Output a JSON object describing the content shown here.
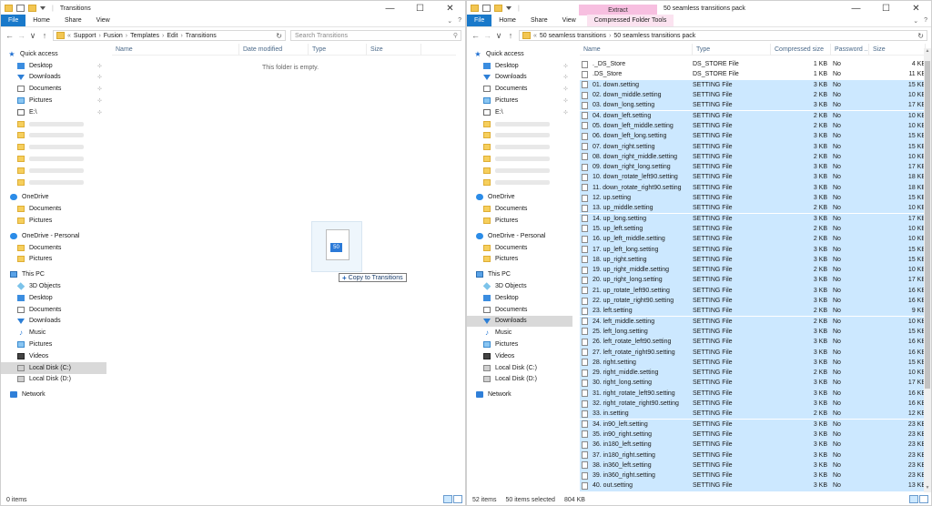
{
  "left_window": {
    "title": "Transitions",
    "window_controls": {
      "minimize": "—",
      "maximize": "☐",
      "close": "✕"
    },
    "ribbon_tabs": [
      "File",
      "Home",
      "Share",
      "View"
    ],
    "address": {
      "back": "←",
      "forward": "→",
      "recent": "∨",
      "up": "↑",
      "prefix": "«",
      "crumbs": [
        "Support",
        "Fusion",
        "Templates",
        "Edit",
        "Transitions"
      ],
      "separator": "›"
    },
    "search_placeholder": "Search Transitions",
    "columns": [
      "Name",
      "Date modified",
      "Type",
      "Size"
    ],
    "empty_message": "This folder is empty.",
    "drag": {
      "badge": "50",
      "tooltip": "Copy to Transitions",
      "tooltip_icon": "+"
    },
    "status": {
      "items": "0 items"
    }
  },
  "right_window": {
    "title": "50 seamless transitions pack",
    "window_controls": {
      "minimize": "—",
      "maximize": "☐",
      "close": "✕"
    },
    "ribbon_tabs": [
      "File",
      "Home",
      "Share",
      "View",
      "Compressed Folder Tools"
    ],
    "context_tab": "Extract",
    "address": {
      "back": "←",
      "forward": "→",
      "recent": "∨",
      "up": "↑",
      "prefix": "«",
      "crumbs": [
        "50 seamless transitions",
        "50 seamless transitions pack"
      ],
      "separator": "›"
    },
    "columns": [
      "Name",
      "Type",
      "Compressed size",
      "Password ...",
      "Size"
    ],
    "status": {
      "items": "52 items",
      "selected": "50 items selected",
      "size": "804 KB"
    }
  },
  "nav": {
    "quick_access": "Quick access",
    "quick_items": [
      "Desktop",
      "Downloads",
      "Documents",
      "Pictures",
      "E:\\"
    ],
    "onedrive": "OneDrive",
    "onedrive_items": [
      "Documents",
      "Pictures"
    ],
    "onedrive_personal": "OneDrive - Personal",
    "onedrive_personal_items": [
      "Documents",
      "Pictures"
    ],
    "this_pc": "This PC",
    "pc_items": [
      "3D Objects",
      "Desktop",
      "Documents",
      "Downloads",
      "Music",
      "Pictures",
      "Videos",
      "Local Disk (C:)",
      "Local Disk (D:)"
    ],
    "network": "Network",
    "pin": "⊹",
    "icons": {
      "quick_access": "★",
      "music": "♪"
    }
  },
  "files": [
    {
      "name": "._DS_Store",
      "type": "DS_STORE File",
      "csize": "1 KB",
      "pw": "No",
      "size": "4 KB",
      "sel": false
    },
    {
      "name": ".DS_Store",
      "type": "DS_STORE File",
      "csize": "1 KB",
      "pw": "No",
      "size": "11 KB",
      "sel": false
    },
    {
      "name": "01. down.setting",
      "type": "SETTING File",
      "csize": "3 KB",
      "pw": "No",
      "size": "15 KB",
      "sel": true
    },
    {
      "name": "02. down_middle.setting",
      "type": "SETTING File",
      "csize": "2 KB",
      "pw": "No",
      "size": "10 KB",
      "sel": true
    },
    {
      "name": "03. down_long.setting",
      "type": "SETTING File",
      "csize": "3 KB",
      "pw": "No",
      "size": "17 KB",
      "sel": true
    },
    {
      "name": "04. down_left.setting",
      "type": "SETTING File",
      "csize": "2 KB",
      "pw": "No",
      "size": "10 KB",
      "sel": true
    },
    {
      "name": "05. down_left_middle.setting",
      "type": "SETTING File",
      "csize": "2 KB",
      "pw": "No",
      "size": "10 KB",
      "sel": true
    },
    {
      "name": "06. down_left_long.setting",
      "type": "SETTING File",
      "csize": "3 KB",
      "pw": "No",
      "size": "15 KB",
      "sel": true
    },
    {
      "name": "07. down_right.setting",
      "type": "SETTING File",
      "csize": "3 KB",
      "pw": "No",
      "size": "15 KB",
      "sel": true
    },
    {
      "name": "08. down_right_middle.setting",
      "type": "SETTING File",
      "csize": "2 KB",
      "pw": "No",
      "size": "10 KB",
      "sel": true
    },
    {
      "name": "09. down_right_long.setting",
      "type": "SETTING File",
      "csize": "3 KB",
      "pw": "No",
      "size": "17 KB",
      "sel": true
    },
    {
      "name": "10. down_rotate_left90.setting",
      "type": "SETTING File",
      "csize": "3 KB",
      "pw": "No",
      "size": "18 KB",
      "sel": true
    },
    {
      "name": "11. down_rotate_right90.setting",
      "type": "SETTING File",
      "csize": "3 KB",
      "pw": "No",
      "size": "18 KB",
      "sel": true
    },
    {
      "name": "12. up.setting",
      "type": "SETTING File",
      "csize": "3 KB",
      "pw": "No",
      "size": "15 KB",
      "sel": true
    },
    {
      "name": "13. up_middle.setting",
      "type": "SETTING File",
      "csize": "2 KB",
      "pw": "No",
      "size": "10 KB",
      "sel": true
    },
    {
      "name": "14. up_long.setting",
      "type": "SETTING File",
      "csize": "3 KB",
      "pw": "No",
      "size": "17 KB",
      "sel": true
    },
    {
      "name": "15. up_left.setting",
      "type": "SETTING File",
      "csize": "2 KB",
      "pw": "No",
      "size": "10 KB",
      "sel": true
    },
    {
      "name": "16. up_left_middle.setting",
      "type": "SETTING File",
      "csize": "2 KB",
      "pw": "No",
      "size": "10 KB",
      "sel": true
    },
    {
      "name": "17. up_left_long.setting",
      "type": "SETTING File",
      "csize": "3 KB",
      "pw": "No",
      "size": "15 KB",
      "sel": true
    },
    {
      "name": "18. up_right.setting",
      "type": "SETTING File",
      "csize": "3 KB",
      "pw": "No",
      "size": "15 KB",
      "sel": true
    },
    {
      "name": "19. up_right_middle.setting",
      "type": "SETTING File",
      "csize": "2 KB",
      "pw": "No",
      "size": "10 KB",
      "sel": true
    },
    {
      "name": "20. up_right_long.setting",
      "type": "SETTING File",
      "csize": "3 KB",
      "pw": "No",
      "size": "17 KB",
      "sel": true
    },
    {
      "name": "21. up_rotate_left90.setting",
      "type": "SETTING File",
      "csize": "3 KB",
      "pw": "No",
      "size": "16 KB",
      "sel": true
    },
    {
      "name": "22. up_rotate_right90.setting",
      "type": "SETTING File",
      "csize": "3 KB",
      "pw": "No",
      "size": "16 KB",
      "sel": true
    },
    {
      "name": "23. left.setting",
      "type": "SETTING File",
      "csize": "2 KB",
      "pw": "No",
      "size": "9 KB",
      "sel": true
    },
    {
      "name": "24. left_middle.setting",
      "type": "SETTING File",
      "csize": "2 KB",
      "pw": "No",
      "size": "10 KB",
      "sel": true
    },
    {
      "name": "25. left_long.setting",
      "type": "SETTING File",
      "csize": "3 KB",
      "pw": "No",
      "size": "15 KB",
      "sel": true
    },
    {
      "name": "26. left_rotate_left90.setting",
      "type": "SETTING File",
      "csize": "3 KB",
      "pw": "No",
      "size": "16 KB",
      "sel": true
    },
    {
      "name": "27. left_rotate_right90.setting",
      "type": "SETTING File",
      "csize": "3 KB",
      "pw": "No",
      "size": "16 KB",
      "sel": true
    },
    {
      "name": "28. right.setting",
      "type": "SETTING File",
      "csize": "3 KB",
      "pw": "No",
      "size": "15 KB",
      "sel": true
    },
    {
      "name": "29. right_middle.setting",
      "type": "SETTING File",
      "csize": "2 KB",
      "pw": "No",
      "size": "10 KB",
      "sel": true
    },
    {
      "name": "30. right_long.setting",
      "type": "SETTING File",
      "csize": "3 KB",
      "pw": "No",
      "size": "17 KB",
      "sel": true
    },
    {
      "name": "31. right_rotate_left90.setting",
      "type": "SETTING File",
      "csize": "3 KB",
      "pw": "No",
      "size": "16 KB",
      "sel": true
    },
    {
      "name": "32. right_rotate_right90.setting",
      "type": "SETTING File",
      "csize": "3 KB",
      "pw": "No",
      "size": "16 KB",
      "sel": true
    },
    {
      "name": "33. in.setting",
      "type": "SETTING File",
      "csize": "2 KB",
      "pw": "No",
      "size": "12 KB",
      "sel": true
    },
    {
      "name": "34. in90_left.setting",
      "type": "SETTING File",
      "csize": "3 KB",
      "pw": "No",
      "size": "23 KB",
      "sel": true
    },
    {
      "name": "35. in90_right.setting",
      "type": "SETTING File",
      "csize": "3 KB",
      "pw": "No",
      "size": "23 KB",
      "sel": true
    },
    {
      "name": "36. in180_left.setting",
      "type": "SETTING File",
      "csize": "3 KB",
      "pw": "No",
      "size": "23 KB",
      "sel": true
    },
    {
      "name": "37. in180_right.setting",
      "type": "SETTING File",
      "csize": "3 KB",
      "pw": "No",
      "size": "23 KB",
      "sel": true
    },
    {
      "name": "38. in360_left.setting",
      "type": "SETTING File",
      "csize": "3 KB",
      "pw": "No",
      "size": "23 KB",
      "sel": true
    },
    {
      "name": "39. in360_right.setting",
      "type": "SETTING File",
      "csize": "3 KB",
      "pw": "No",
      "size": "23 KB",
      "sel": true
    },
    {
      "name": "40. out.setting",
      "type": "SETTING File",
      "csize": "3 KB",
      "pw": "No",
      "size": "13 KB",
      "sel": true
    }
  ]
}
